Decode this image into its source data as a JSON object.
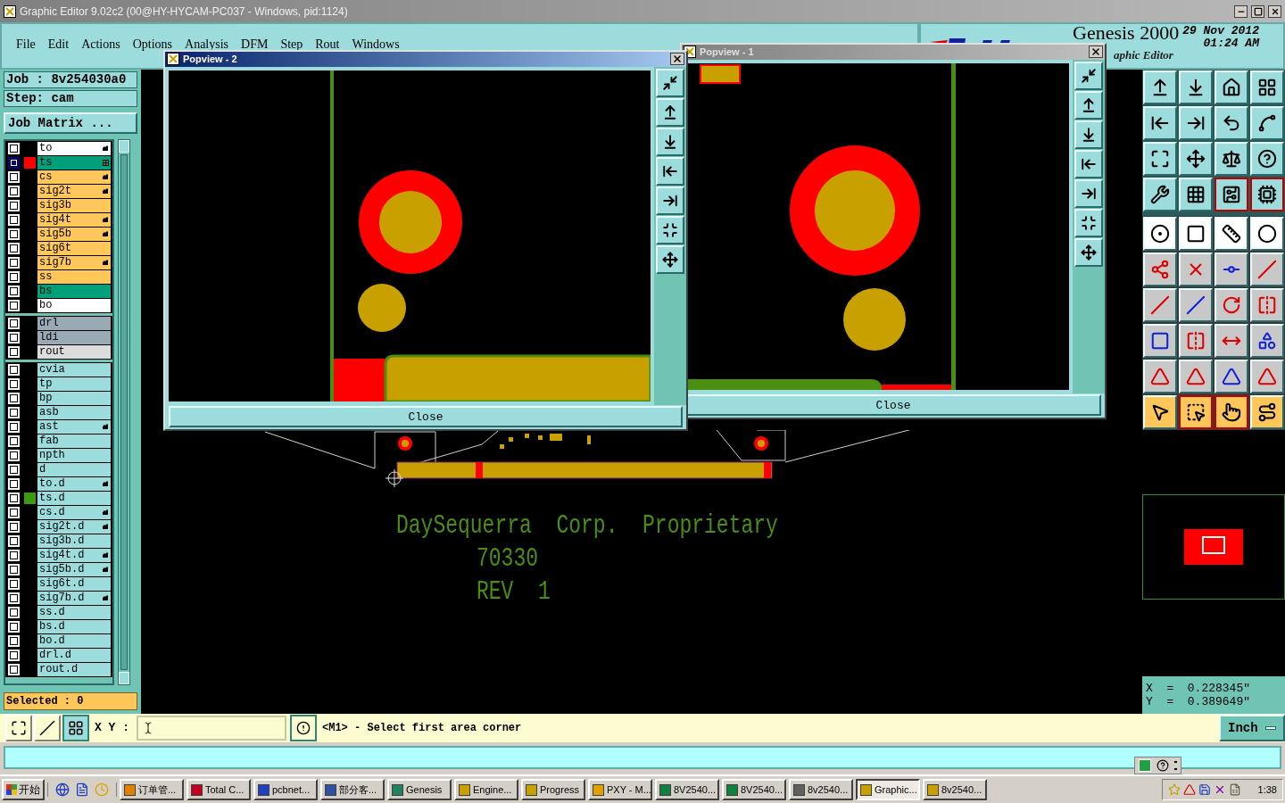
{
  "window": {
    "title": "Graphic Editor 9.02c2 (00@HY-HYCAM-PC037 - Windows, pid:1124)"
  },
  "menu": [
    "File",
    "Edit",
    "Actions",
    "Options",
    "Analysis",
    "DFM",
    "Step",
    "Rout",
    "Windows"
  ],
  "header": {
    "product": "Genesis 2000",
    "subtitle": "aphic Editor",
    "date": "29 Nov 2012",
    "time": "01:24 AM"
  },
  "job": {
    "job": "Job : 8v254030a0",
    "step": "Step: cam",
    "matrix_button": "Job Matrix ..."
  },
  "layer_groups": [
    {
      "layers": [
        {
          "name": "to",
          "color": "#ffffff",
          "selected": false,
          "kind": "affected"
        },
        {
          "name": "ts",
          "color": "#00a07a",
          "selected": true,
          "kind": "work",
          "swatch": {
            "color": "#ff0000"
          }
        },
        {
          "name": "cs",
          "color": "#ffc65a",
          "selected": false,
          "kind": "affected"
        },
        {
          "name": "sig2t",
          "color": "#ffc65a",
          "selected": false,
          "kind": "affected"
        },
        {
          "name": "sig3b",
          "color": "#ffc65a",
          "selected": false
        },
        {
          "name": "sig4t",
          "color": "#ffc65a",
          "selected": false,
          "kind": "affected"
        },
        {
          "name": "sig5b",
          "color": "#ffc65a",
          "selected": false,
          "kind": "affected"
        },
        {
          "name": "sig6t",
          "color": "#ffc65a",
          "selected": false
        },
        {
          "name": "sig7b",
          "color": "#ffc65a",
          "selected": false,
          "kind": "affected"
        },
        {
          "name": "ss",
          "color": "#ffc65a",
          "selected": false
        },
        {
          "name": "bs",
          "color": "#00a07a",
          "selected": false
        },
        {
          "name": "bo",
          "color": "#ffffff",
          "selected": false
        }
      ]
    },
    {
      "layers": [
        {
          "name": "drl",
          "color": "#9aaab4",
          "selected": false
        },
        {
          "name": "ldi",
          "color": "#9aaab4",
          "selected": false
        },
        {
          "name": "rout",
          "color": "#dcdcdc",
          "selected": false
        }
      ]
    },
    {
      "layers": [
        {
          "name": "cvia",
          "color": "#9ddcdc",
          "selected": false
        },
        {
          "name": "tp",
          "color": "#9ddcdc",
          "selected": false
        },
        {
          "name": "bp",
          "color": "#9ddcdc",
          "selected": false
        },
        {
          "name": "asb",
          "color": "#9ddcdc",
          "selected": false
        },
        {
          "name": "ast",
          "color": "#9ddcdc",
          "selected": false,
          "kind": "affected"
        },
        {
          "name": "fab",
          "color": "#9ddcdc",
          "selected": false
        },
        {
          "name": "npth",
          "color": "#9ddcdc",
          "selected": false
        },
        {
          "name": "d",
          "color": "#9ddcdc",
          "selected": false
        },
        {
          "name": "to.d",
          "color": "#9ddcdc",
          "selected": false,
          "kind": "affected"
        },
        {
          "name": "ts.d",
          "color": "#9ddcdc",
          "selected": false,
          "swatch": {
            "color": "#3c9a10"
          }
        },
        {
          "name": "cs.d",
          "color": "#9ddcdc",
          "selected": false,
          "kind": "affected"
        },
        {
          "name": "sig2t.d",
          "color": "#9ddcdc",
          "selected": false,
          "kind": "affected"
        },
        {
          "name": "sig3b.d",
          "color": "#9ddcdc",
          "selected": false
        },
        {
          "name": "sig4t.d",
          "color": "#9ddcdc",
          "selected": false,
          "kind": "affected"
        },
        {
          "name": "sig5b.d",
          "color": "#9ddcdc",
          "selected": false,
          "kind": "affected"
        },
        {
          "name": "sig6t.d",
          "color": "#9ddcdc",
          "selected": false
        },
        {
          "name": "sig7b.d",
          "color": "#9ddcdc",
          "selected": false,
          "kind": "affected"
        },
        {
          "name": "ss.d",
          "color": "#9ddcdc",
          "selected": false
        },
        {
          "name": "bs.d",
          "color": "#9ddcdc",
          "selected": false
        },
        {
          "name": "bo.d",
          "color": "#9ddcdc",
          "selected": false
        },
        {
          "name": "drl.d",
          "color": "#9ddcdc",
          "selected": false
        },
        {
          "name": "rout.d",
          "color": "#9ddcdc",
          "selected": false
        }
      ]
    }
  ],
  "selected_count": "Selected : 0",
  "popviews": [
    {
      "title": "Popview - 1",
      "active": false,
      "close_button": "Close"
    },
    {
      "title": "Popview - 2",
      "active": true,
      "close_button": "Close"
    }
  ],
  "canvas": {
    "texts": [
      "DaySequerra  Corp.  Proprietary",
      "70330",
      "REV  1"
    ]
  },
  "coordinates": {
    "x": "X  =  0.228345\"",
    "y": "Y  =  0.389649\""
  },
  "input_bar": {
    "label": "X Y :",
    "message": "<M1> - Select first area corner",
    "units": "Inch"
  },
  "taskbar": {
    "start": "开始",
    "items": [
      {
        "label": "订单管...",
        "selected": false
      },
      {
        "label": "Total C...",
        "selected": false
      },
      {
        "label": "pcbnet...",
        "selected": false
      },
      {
        "label": "部分客...",
        "selected": false
      },
      {
        "label": "Genesis",
        "selected": false
      },
      {
        "label": "Engine...",
        "selected": false
      },
      {
        "label": "Progress",
        "selected": false
      },
      {
        "label": "PXY - M...",
        "selected": false
      },
      {
        "label": "8V2540...",
        "selected": false
      },
      {
        "label": "8V2540...",
        "selected": false
      },
      {
        "label": "8v2540...",
        "selected": false
      },
      {
        "label": "Graphic...",
        "selected": true
      },
      {
        "label": "8v2540...",
        "selected": false
      }
    ],
    "clock": "1:38"
  }
}
